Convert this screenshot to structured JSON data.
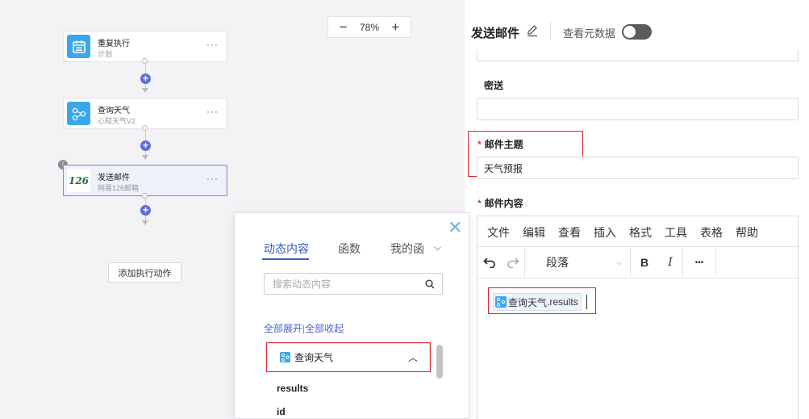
{
  "canvas": {
    "zoom": {
      "minus_icon": "minus",
      "value": "78%",
      "plus_icon": "plus"
    },
    "nodes": [
      {
        "title": "重复执行",
        "subtitle": "计划",
        "icon": "calendar-icon",
        "icon_bg": "#3aa7ea"
      },
      {
        "title": "查询天气",
        "subtitle": "心知天气V2",
        "icon": "weather-flow-icon",
        "icon_bg": "#3aa7ea"
      },
      {
        "title": "发送邮件",
        "subtitle": "网易126邮箱",
        "icon": "mail126-icon",
        "icon_text": "126"
      }
    ],
    "more_glyph": "···",
    "connector_glyph": "+",
    "badge_glyph": "!",
    "add_action_label": "添加执行动作"
  },
  "popup": {
    "tabs": [
      "动态内容",
      "函数",
      "我的函"
    ],
    "search_placeholder": "搜索动态内容",
    "expand_all": "全部展开",
    "divider": "|",
    "collapse_all": "全部收起",
    "group_label": "查询天气",
    "fields": [
      "results",
      "id"
    ]
  },
  "panel": {
    "title": "发送邮件",
    "view_metadata": "查看元数据",
    "labels": {
      "bcc": "密送",
      "subject": "邮件主题",
      "content": "邮件内容"
    },
    "required_mark": "*",
    "subject_value": "天气预报",
    "editor": {
      "menu": [
        "文件",
        "编辑",
        "查看",
        "插入",
        "格式",
        "工具",
        "表格",
        "帮助"
      ],
      "paragraph_select": "段落",
      "bold": "B",
      "italic": "I",
      "more": "•••",
      "chip_prefix": "查询天气",
      "chip_suffix": ".results"
    }
  },
  "colors": {
    "accent": "#4059c9",
    "highlight_red": "#d9262c",
    "node_icon_blue": "#3aa7ea"
  }
}
